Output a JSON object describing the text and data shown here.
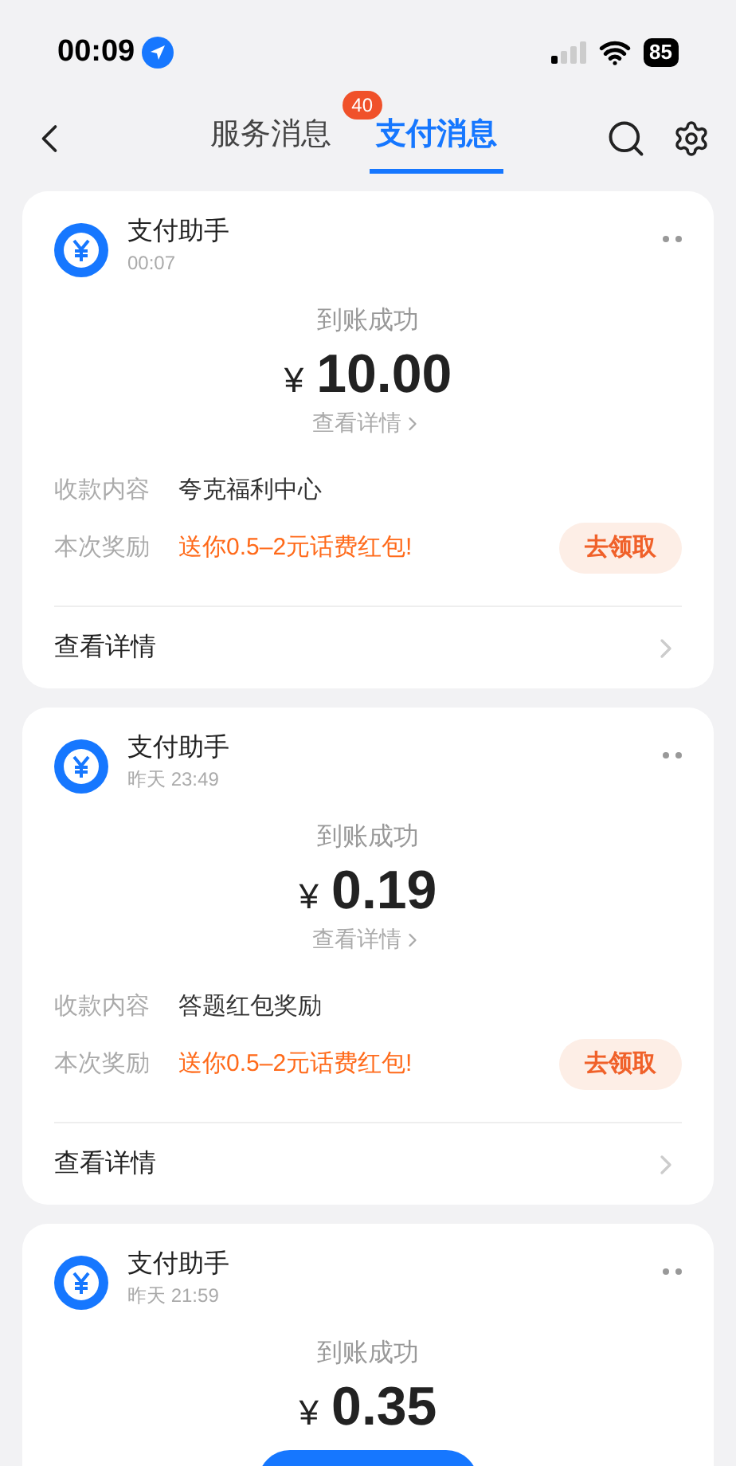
{
  "status_bar": {
    "time": "00:09",
    "battery": "85"
  },
  "nav": {
    "tabs": [
      {
        "label": "服务消息",
        "selected": false,
        "badge": "40"
      },
      {
        "label": "支付消息",
        "selected": true
      }
    ]
  },
  "messages": [
    {
      "sender": "支付助手",
      "time": "00:07",
      "status": "到账成功",
      "currency": "¥",
      "amount": "10.00",
      "detail_link": "查看详情",
      "fields": [
        {
          "label": "收款内容",
          "value": "夸克福利中心",
          "kind": "plain"
        },
        {
          "label": "本次奖励",
          "value": "送你0.5–2元话费红包!",
          "kind": "reward",
          "action": "去领取"
        }
      ],
      "footer": "查看详情"
    },
    {
      "sender": "支付助手",
      "time": "昨天 23:49",
      "status": "到账成功",
      "currency": "¥",
      "amount": "0.19",
      "detail_link": "查看详情",
      "fields": [
        {
          "label": "收款内容",
          "value": "答题红包奖励",
          "kind": "plain"
        },
        {
          "label": "本次奖励",
          "value": "送你0.5–2元话费红包!",
          "kind": "reward",
          "action": "去领取"
        }
      ],
      "footer": "查看详情"
    },
    {
      "sender": "支付助手",
      "time": "昨天 21:59",
      "status": "到账成功",
      "currency": "¥",
      "amount": "0.35"
    }
  ]
}
